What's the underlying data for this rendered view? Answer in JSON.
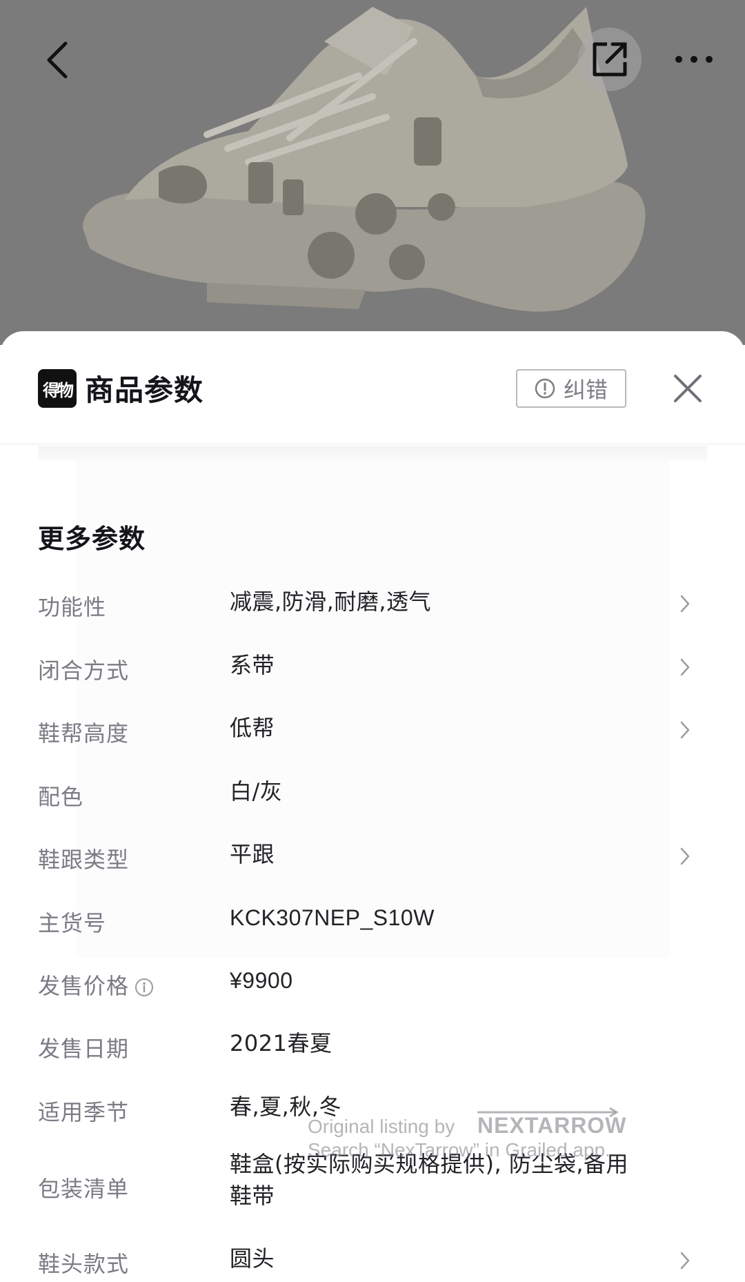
{
  "nav": {
    "back_icon": "chevron-left-icon",
    "share_icon": "share-external-icon",
    "more_icon": "more-horizontal-icon"
  },
  "sheet": {
    "brand_logo_text": "得物",
    "title": "商品参数",
    "report_label": "纠错",
    "close_icon": "close-icon"
  },
  "section": {
    "title": "更多参数"
  },
  "params": [
    {
      "label": "功能性",
      "value": "减震,防滑,耐磨,透气",
      "has_arrow": true
    },
    {
      "label": "闭合方式",
      "value": "系带",
      "has_arrow": true
    },
    {
      "label": "鞋帮高度",
      "value": "低帮",
      "has_arrow": true
    },
    {
      "label": "配色",
      "value": "白/灰",
      "has_arrow": false
    },
    {
      "label": "鞋跟类型",
      "value": "平跟",
      "has_arrow": true
    },
    {
      "label": "主货号",
      "value": "KCK307NEP_S10W",
      "has_arrow": false
    },
    {
      "label": "发售价格",
      "value": "¥9900",
      "has_arrow": false,
      "info_icon": true
    },
    {
      "label": "发售日期",
      "value": "2021春夏",
      "has_arrow": false
    },
    {
      "label": "适用季节",
      "value": "春,夏,秋,冬",
      "has_arrow": false
    },
    {
      "label": "包装清单",
      "value": "鞋盒(按实际购买规格提供), 防尘袋,备用鞋带",
      "has_arrow": false
    },
    {
      "label": "鞋头款式",
      "value": "圆头",
      "has_arrow": true
    }
  ],
  "watermark": {
    "line1": "Original listing by",
    "brand": "NEXTARROW",
    "line2": "Search “NexTarrow” in Grailed app."
  },
  "colors": {
    "hero_bg": "#8a8a8a",
    "label": "#7b7b84",
    "value": "#222227",
    "title": "#14151a"
  }
}
